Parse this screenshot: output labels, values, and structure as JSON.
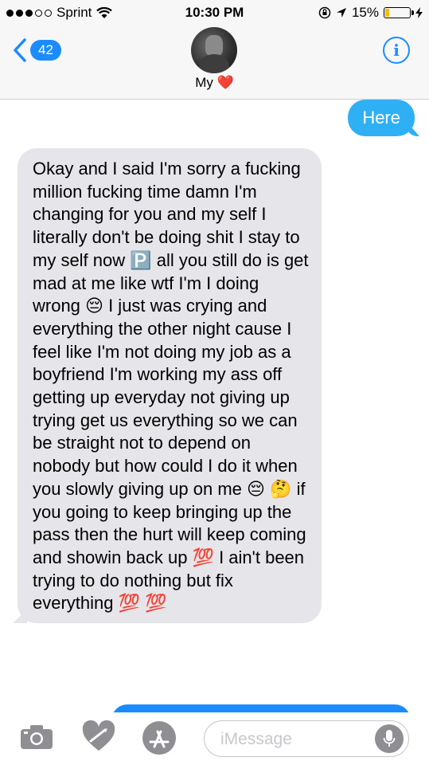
{
  "status_bar": {
    "carrier": "Sprint",
    "time": "10:30 PM",
    "battery_percent": "15%",
    "signal_bars_filled": 3,
    "signal_bars_total": 5,
    "icons": [
      "wifi-icon",
      "lock-rotation-icon",
      "location-arrow-icon",
      "battery-icon",
      "charging-bolt-icon"
    ]
  },
  "header": {
    "back_badge": "42",
    "contact_name": "My",
    "contact_emoji": "❤️",
    "info_label": "i"
  },
  "messages": [
    {
      "direction": "outgoing",
      "text": "Here"
    },
    {
      "direction": "incoming",
      "text": "Okay and I said I'm sorry a fucking million fucking time damn I'm changing for you and my self I literally don't be doing shit I stay to my self now 🅿️ all you still do is get mad at me like wtf I'm I doing wrong 😔 I just was crying and everything the other night cause I feel like I'm not doing my job as a boyfriend I'm working my ass off getting up everyday not giving up trying get us everything so we can be straight not to depend on nobody but how could I do it when you slowly giving up on me 😔 🤔 if you going to keep bringing up the pass then the hurt will keep coming and showin back up 💯 I ain't been trying to do nothing but fix everything 💯 💯"
    }
  ],
  "input_bar": {
    "placeholder": "iMessage"
  },
  "colors": {
    "accent": "#1a8cff",
    "outgoing_bubble": "#2fb0f5",
    "incoming_bubble": "#e5e5ea",
    "heart": "#e3102d"
  }
}
